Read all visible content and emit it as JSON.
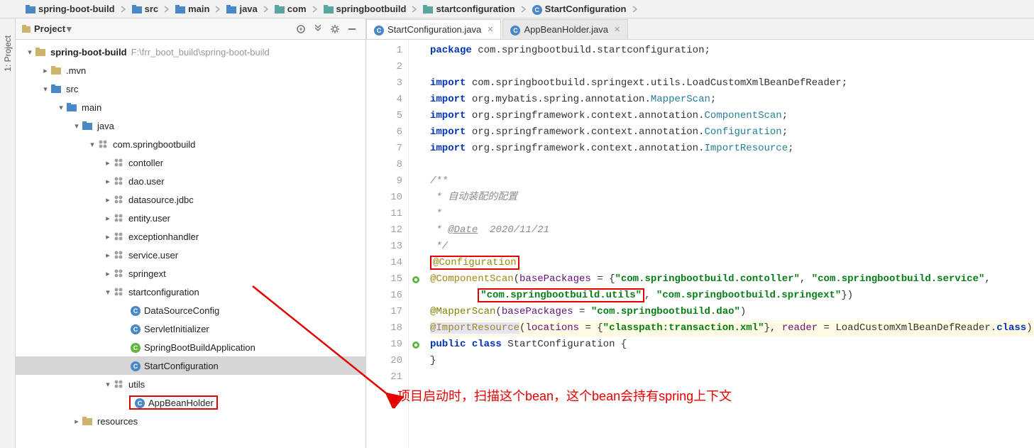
{
  "breadcrumb": [
    {
      "icon": "folder-blue",
      "label": "spring-boot-build"
    },
    {
      "icon": "folder-blue",
      "label": "src"
    },
    {
      "icon": "folder-blue",
      "label": "main"
    },
    {
      "icon": "folder-blue",
      "label": "java"
    },
    {
      "icon": "folder-teal",
      "label": "com"
    },
    {
      "icon": "folder-teal",
      "label": "springbootbuild"
    },
    {
      "icon": "folder-teal",
      "label": "startconfiguration"
    },
    {
      "icon": "class",
      "label": "StartConfiguration"
    }
  ],
  "panel": {
    "title": "Project",
    "rail_label": "1: Project"
  },
  "tree": [
    {
      "depth": 0,
      "arrow": "expanded",
      "icon": "folder-root",
      "label": "spring-boot-build",
      "bold": true,
      "hint": "F:\\frr_boot_build\\spring-boot-build"
    },
    {
      "depth": 1,
      "arrow": "collapsed",
      "icon": "folder",
      "label": ".mvn"
    },
    {
      "depth": 1,
      "arrow": "expanded",
      "icon": "folder-blue",
      "label": "src"
    },
    {
      "depth": 2,
      "arrow": "expanded",
      "icon": "folder-blue",
      "label": "main"
    },
    {
      "depth": 3,
      "arrow": "expanded",
      "icon": "folder-blue",
      "label": "java"
    },
    {
      "depth": 4,
      "arrow": "expanded",
      "icon": "pkg",
      "label": "com.springbootbuild"
    },
    {
      "depth": 5,
      "arrow": "collapsed",
      "icon": "pkg",
      "label": "contoller"
    },
    {
      "depth": 5,
      "arrow": "collapsed",
      "icon": "pkg",
      "label": "dao.user"
    },
    {
      "depth": 5,
      "arrow": "collapsed",
      "icon": "pkg",
      "label": "datasource.jdbc"
    },
    {
      "depth": 5,
      "arrow": "collapsed",
      "icon": "pkg",
      "label": "entity.user"
    },
    {
      "depth": 5,
      "arrow": "collapsed",
      "icon": "pkg",
      "label": "exceptionhandler"
    },
    {
      "depth": 5,
      "arrow": "collapsed",
      "icon": "pkg",
      "label": "service.user"
    },
    {
      "depth": 5,
      "arrow": "collapsed",
      "icon": "pkg",
      "label": "springext"
    },
    {
      "depth": 5,
      "arrow": "expanded",
      "icon": "pkg",
      "label": "startconfiguration"
    },
    {
      "depth": 6,
      "arrow": "none",
      "icon": "class",
      "label": "DataSourceConfig"
    },
    {
      "depth": 6,
      "arrow": "none",
      "icon": "class",
      "label": "ServletInitializer"
    },
    {
      "depth": 6,
      "arrow": "none",
      "icon": "class-run",
      "label": "SpringBootBuildApplication"
    },
    {
      "depth": 6,
      "arrow": "none",
      "icon": "class",
      "label": "StartConfiguration",
      "selected": true
    },
    {
      "depth": 5,
      "arrow": "expanded",
      "icon": "pkg",
      "label": "utils"
    },
    {
      "depth": 6,
      "arrow": "none",
      "icon": "class",
      "label": "AppBeanHolder",
      "redbox": true
    },
    {
      "depth": 3,
      "arrow": "collapsed",
      "icon": "folder-res",
      "label": "resources"
    }
  ],
  "tabs": [
    {
      "icon": "class",
      "label": "StartConfiguration.java",
      "active": true
    },
    {
      "icon": "class",
      "label": "AppBeanHolder.java",
      "active": false
    }
  ],
  "code": {
    "lines": [
      {
        "n": 1,
        "html": "<span class='kw'>package</span> com.springbootbuild.startconfiguration;"
      },
      {
        "n": 2,
        "html": ""
      },
      {
        "n": 3,
        "html": "<span class='kw'>import</span> com.springbootbuild.springext.utils.LoadCustomXmlBeanDefReader;"
      },
      {
        "n": 4,
        "html": "<span class='kw'>import</span> org.mybatis.spring.annotation.<span class='cls'>MapperScan</span>;"
      },
      {
        "n": 5,
        "html": "<span class='kw'>import</span> org.springframework.context.annotation.<span class='cls'>ComponentScan</span>;"
      },
      {
        "n": 6,
        "html": "<span class='kw'>import</span> org.springframework.context.annotation.<span class='cls'>Configuration</span>;"
      },
      {
        "n": 7,
        "html": "<span class='kw'>import</span> org.springframework.context.annotation.<span class='cls'>ImportResource</span>;"
      },
      {
        "n": 8,
        "html": ""
      },
      {
        "n": 9,
        "html": "<span class='cmt'>/**</span>"
      },
      {
        "n": 10,
        "html": "<span class='cmt'> * 自动装配的配置</span>"
      },
      {
        "n": 11,
        "html": "<span class='cmt'> *</span>"
      },
      {
        "n": 12,
        "html": "<span class='cmt'> * <span class='cmt-tag'>@Date</span>  2020/11/21</span>"
      },
      {
        "n": 13,
        "html": "<span class='cmt'> */</span>"
      },
      {
        "n": 14,
        "html": "<span class='red-outline'><span class='ann'>@Configuration</span></span>"
      },
      {
        "n": 15,
        "html": "<span class='ann'>@ComponentScan</span>(<span class='fld'>basePackages</span> = {<span class='str'>\"com.springbootbuild.contoller\"</span>, <span class='str'>\"com.springbootbuild.service\"</span>,",
        "gicon": "bean"
      },
      {
        "n": 16,
        "html": "        <span class='red-outline'><span class='str'>\"com.springbootbuild.utils\"</span></span>, <span class='str'>\"com.springbootbuild.springext\"</span>})"
      },
      {
        "n": 17,
        "html": "<span class='ann2'>@MapperScan</span>(<span class='fld'>basePackages</span> = <span class='str'>\"com.springbootbuild.dao\"</span>)"
      },
      {
        "n": 18,
        "html": "<span class='hl-span'><span class='ann'>@ImportResource</span></span>(<span class='fld'>locations</span> = {<span class='str'>\"classpath:transaction.xml\"</span>}, <span class='fld'>reader</span> = LoadCustomXmlBeanDefReader.<span class='kw'>class</span>)",
        "hl": true
      },
      {
        "n": 19,
        "html": "<span class='kw'>public</span> <span class='kw'>class</span> StartConfiguration {",
        "gicon": "bean"
      },
      {
        "n": 20,
        "html": "}"
      },
      {
        "n": 21,
        "html": ""
      }
    ]
  },
  "annotation": "项目启动时，扫描这个bean，这个bean会持有spring上下文"
}
